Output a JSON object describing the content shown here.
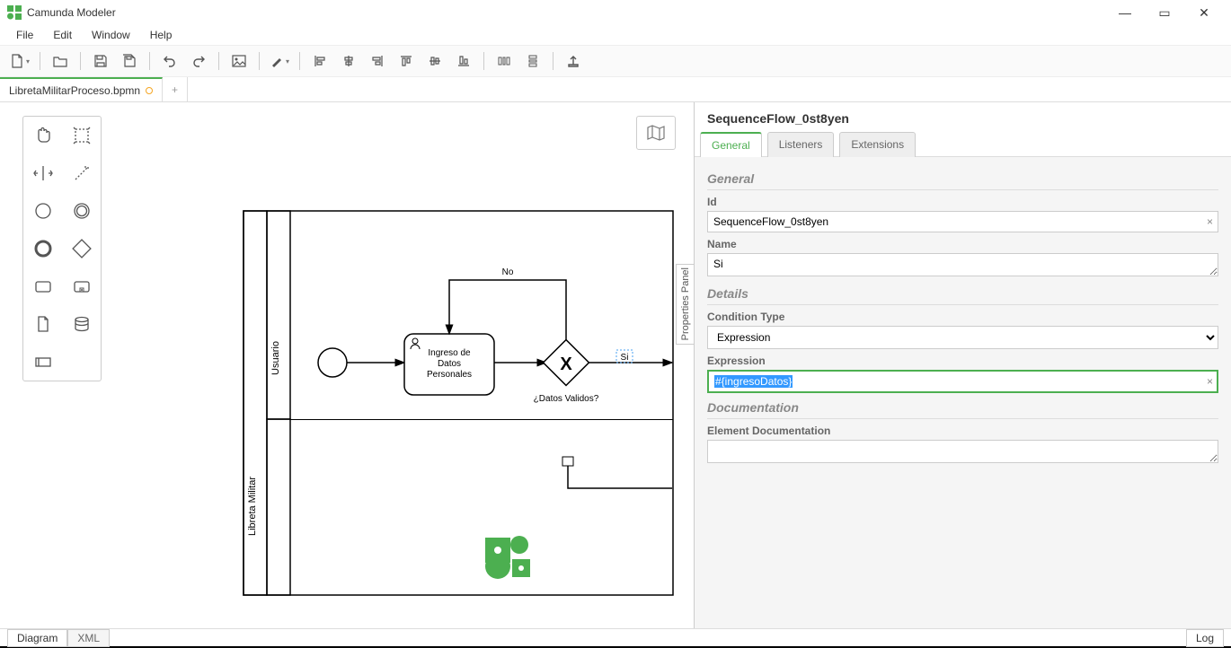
{
  "window": {
    "title": "Camunda Modeler",
    "minimize": "—",
    "maximize": "▭",
    "close": "✕"
  },
  "menu": {
    "file": "File",
    "edit": "Edit",
    "window": "Window",
    "help": "Help"
  },
  "tabs": {
    "file": "LibretaMilitarProceso.bpmn",
    "newtab": "+"
  },
  "panel_toggle": "Properties Panel",
  "diagram": {
    "pool_label": "Libreta Militar",
    "lane_user": "Usuario",
    "task_ingreso": "Ingreso de Datos Personales",
    "gateway_label": "¿Datos Validos?",
    "flow_no": "No",
    "flow_si": "Si"
  },
  "props": {
    "element_name": "SequenceFlow_0st8yen",
    "tabs": {
      "general": "General",
      "listeners": "Listeners",
      "extensions": "Extensions"
    },
    "groups": {
      "general": "General",
      "details": "Details",
      "documentation": "Documentation"
    },
    "labels": {
      "id": "Id",
      "name": "Name",
      "condition_type": "Condition Type",
      "expression": "Expression",
      "element_doc": "Element Documentation"
    },
    "values": {
      "id": "SequenceFlow_0st8yen",
      "name": "Si",
      "condition_type": "Expression",
      "expression": "#{ingresoDatos}",
      "element_doc": ""
    }
  },
  "bottom": {
    "diagram": "Diagram",
    "xml": "XML",
    "log": "Log"
  }
}
